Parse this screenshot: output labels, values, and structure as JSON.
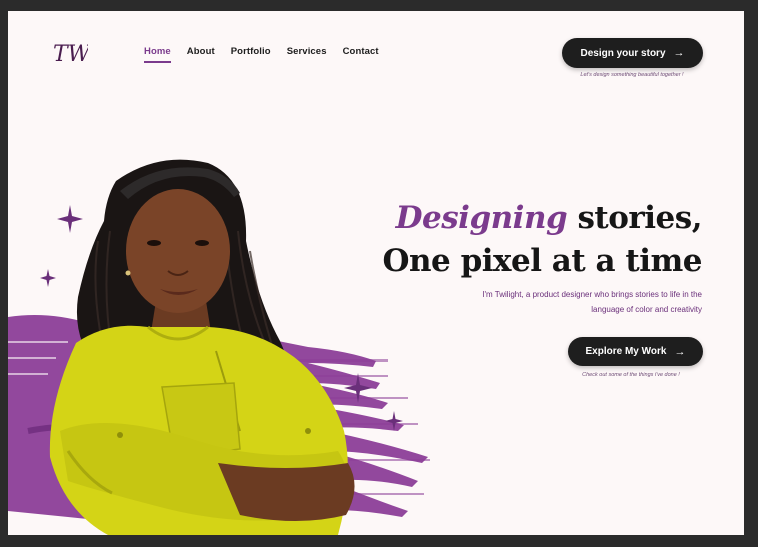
{
  "logo": {
    "text": "TW"
  },
  "nav": {
    "items": [
      {
        "label": "Home",
        "active": true
      },
      {
        "label": "About",
        "active": false
      },
      {
        "label": "Portfolio",
        "active": false
      },
      {
        "label": "Services",
        "active": false
      },
      {
        "label": "Contact",
        "active": false
      }
    ]
  },
  "cta": {
    "design_label": "Design your story",
    "design_caption": "Let's design something beautiful together !",
    "explore_label": "Explore My Work",
    "explore_caption": "Check out some of the things i've done !"
  },
  "hero": {
    "title_accent": "Designing",
    "title_rest": " stories,",
    "title_line2": "One pixel at a time",
    "description_line1": "I'm Twilight, a product designer who brings stories to life in the",
    "description_line2": "language of color and creativity"
  },
  "colors": {
    "accent": "#7b3b8d",
    "button_bg": "#1e1e1e",
    "page_bg": "#fdf8f8",
    "shirt": "#d4d416"
  },
  "icons": [
    "arrow-right-icon",
    "sparkle-icon"
  ],
  "image": {
    "subject": "portrait-photo"
  }
}
